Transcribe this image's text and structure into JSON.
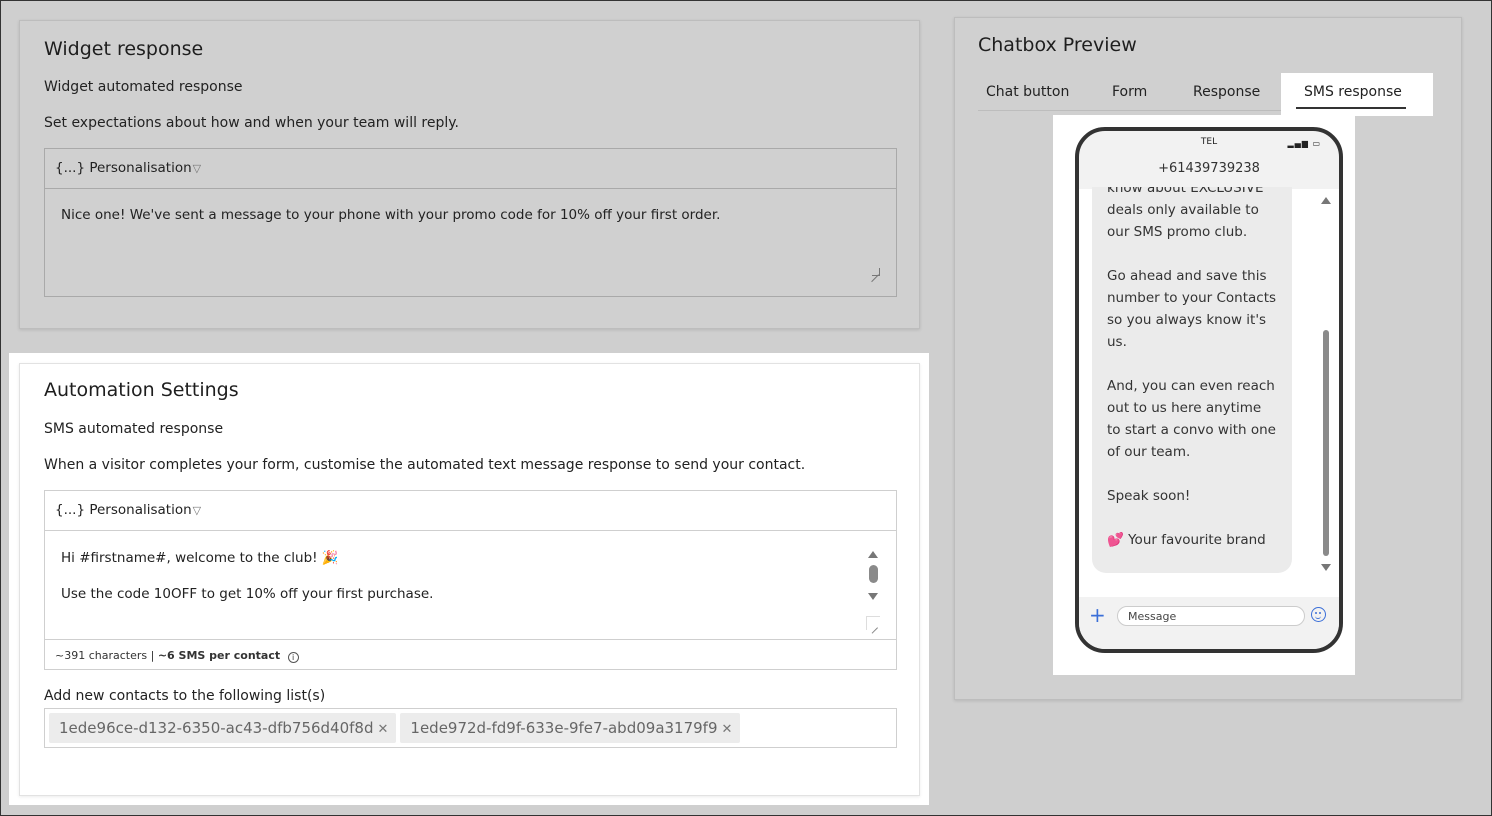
{
  "widget": {
    "title": "Widget response",
    "subtitle": "Widget automated response",
    "description": "Set expectations about how and when your team will reply.",
    "personalisation_label": "{...} Personalisation",
    "message": "Nice one! We've sent a message to your phone with your promo code for 10% off your first order."
  },
  "automation": {
    "title": "Automation Settings",
    "subtitle": "SMS automated response",
    "description": "When a visitor completes your form, customise the automated text message response to send your contact.",
    "personalisation_label": "{...} Personalisation",
    "message_line1": "Hi #firstname#, welcome to the club! 🎉",
    "message_line2": "Use the code 10OFF to get 10% off your first purchase.",
    "char_count": "~391 characters |",
    "sms_count": "~6 SMS per contact",
    "lists_label": "Add new contacts to the following list(s)",
    "lists": [
      "1ede96ce-d132-6350-ac43-dfb756d40f8d",
      "1ede972d-fd9f-633e-9fe7-abd09a3179f9"
    ]
  },
  "preview": {
    "title": "Chatbox Preview",
    "tabs": [
      {
        "label": "Chat button",
        "active": false
      },
      {
        "label": "Form",
        "active": false
      },
      {
        "label": "Response",
        "active": false
      },
      {
        "label": "SMS response",
        "active": true
      }
    ],
    "carrier": "TEL",
    "phone_number": "+61439739238",
    "bubble": {
      "para1_partial": "know about EXCLUSIVE deals only available to our SMS promo club.",
      "para2": "Go ahead and save this number to your Contacts so you always know it's us.",
      "para3": "And, you can even reach out to us here anytime to start a convo with one of our team.",
      "para4": "Speak soon!",
      "signoff": "💕 Your favourite brand"
    },
    "message_placeholder": "Message"
  },
  "icons": {
    "chevron": "chevron-down-icon",
    "info": "info-icon",
    "remove": "close-icon",
    "plus": "plus-icon",
    "emoji": "emoji-icon"
  }
}
